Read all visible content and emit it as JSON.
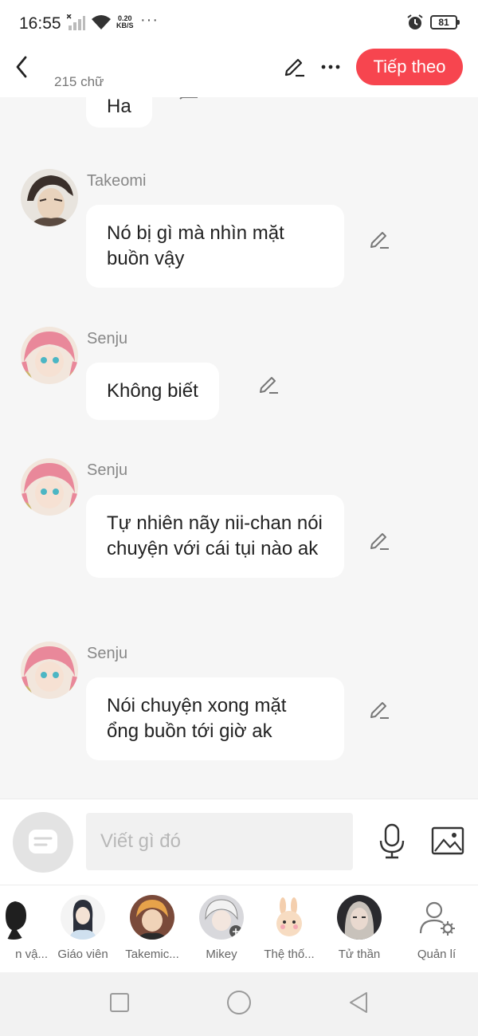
{
  "status_bar": {
    "time": "16:55",
    "speed_value": "0.20",
    "speed_unit": "KB/S",
    "dots": "···",
    "battery": "81"
  },
  "header": {
    "word_count": "215 chữ",
    "next_label": "Tiếp theo"
  },
  "chat": {
    "partial_bubble": "Ha",
    "messages": [
      {
        "sender": "Takeomi",
        "text": "Nó bị gì mà nhìn mặt buồn vậy"
      },
      {
        "sender": "Senju",
        "text": "Không biết"
      },
      {
        "sender": "Senju",
        "text": "Tự nhiên nãy nii-chan nói chuyện với cái tụi nào ak"
      },
      {
        "sender": "Senju",
        "text": "Nói chuyện xong mặt ổng buồn tới giờ ak"
      }
    ]
  },
  "input": {
    "placeholder": "Viết gì đó"
  },
  "characters": [
    {
      "name": "n vậ..."
    },
    {
      "name": "Giáo viên"
    },
    {
      "name": "Takemic..."
    },
    {
      "name": "Mikey"
    },
    {
      "name": "Thệ thố..."
    },
    {
      "name": "Tử thần"
    },
    {
      "name": "Quản lí"
    }
  ],
  "icons": {
    "back": "chevron-left-icon",
    "edit": "pencil-icon",
    "more": "more-horizontal-icon",
    "mic": "microphone-icon",
    "image": "image-icon",
    "manage": "user-settings-icon"
  },
  "colors": {
    "accent": "#f7454f",
    "bubble": "#ffffff",
    "background": "#f6f6f6"
  }
}
